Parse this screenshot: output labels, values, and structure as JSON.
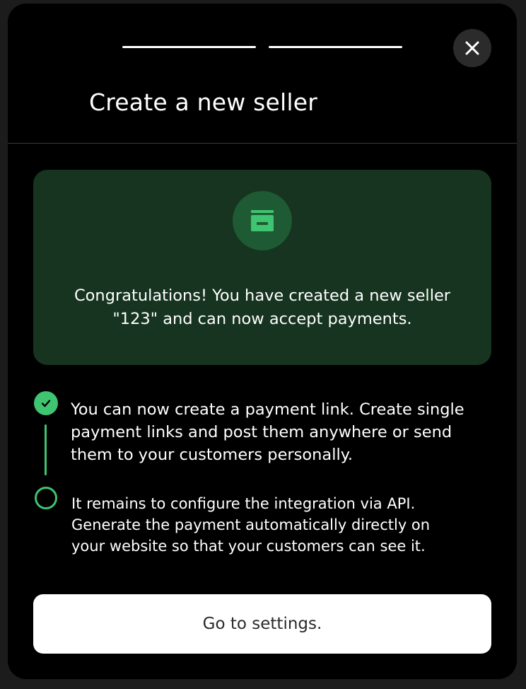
{
  "header": {
    "title": "Create a new seller",
    "progress_steps": 2,
    "close_icon": "close-icon"
  },
  "success_card": {
    "icon": "store-icon",
    "message": "Congratulations! You have created a new seller \"123\" and can now accept payments."
  },
  "steps": [
    {
      "status": "completed",
      "icon": "check-icon",
      "text": "You can now create a payment link. Create single payment links and post them anywhere or send them to your customers personally."
    },
    {
      "status": "pending",
      "icon": "circle-icon",
      "text": "It remains to configure the integration via API. Generate the payment automatically directly on your website so that your customers can see it."
    }
  ],
  "actions": {
    "settings_label": "Go to settings."
  },
  "colors": {
    "accent_green": "#3fc472",
    "card_bg": "#16341f",
    "icon_circle_bg": "#1e5a33",
    "modal_bg": "#000000"
  }
}
